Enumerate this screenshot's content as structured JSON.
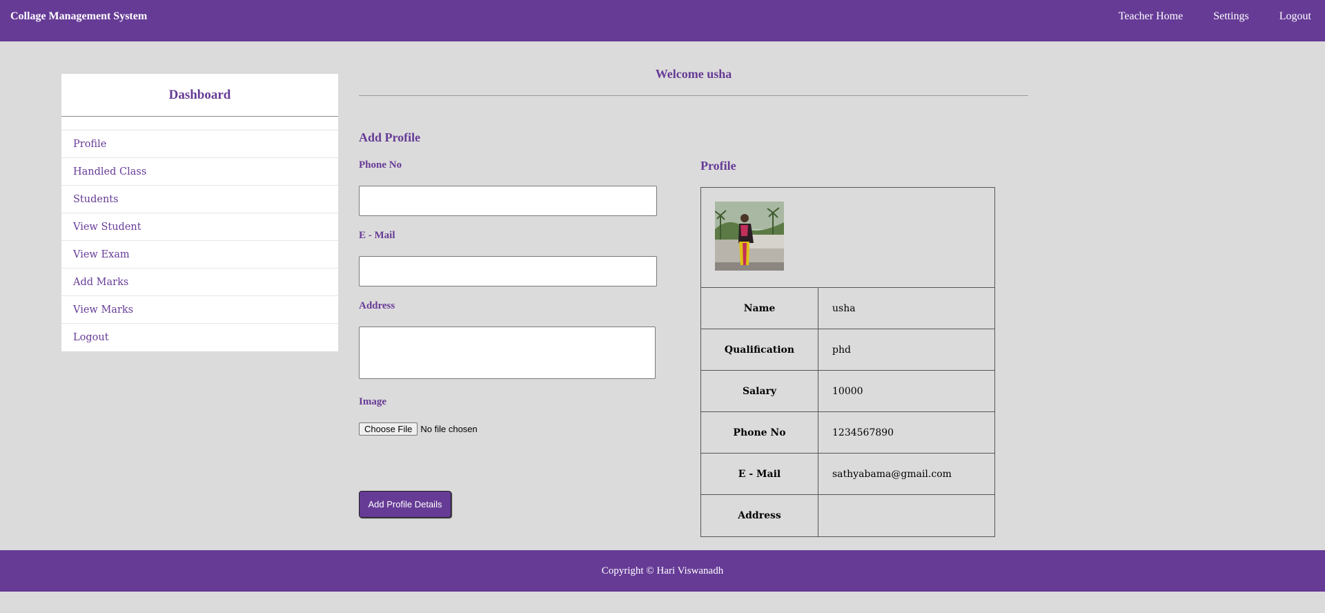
{
  "header": {
    "brand": "Collage Management System",
    "nav": [
      "Teacher Home",
      "Settings",
      "Logout"
    ]
  },
  "sidebar": {
    "title": "Dashboard",
    "items": [
      "Profile",
      "Handled Class",
      "Students",
      "View Student",
      "View Exam",
      "Add Marks",
      "View Marks",
      "Logout"
    ]
  },
  "main": {
    "welcome": "Welcome usha",
    "form": {
      "title": "Add Profile",
      "phone_label": "Phone No",
      "phone_value": "",
      "email_label": "E - Mail",
      "email_value": "",
      "address_label": "Address",
      "address_value": "",
      "image_label": "Image",
      "file_button": "Choose File",
      "file_status": "No file chosen",
      "submit_label": "Add Profile Details"
    },
    "profile": {
      "title": "Profile",
      "rows": [
        {
          "key": "Name",
          "value": "usha"
        },
        {
          "key": "Qualification",
          "value": "phd"
        },
        {
          "key": "Salary",
          "value": "10000"
        },
        {
          "key": "Phone No",
          "value": "1234567890"
        },
        {
          "key": "E - Mail",
          "value": "sathyabama@gmail.com"
        },
        {
          "key": "Address",
          "value": ""
        }
      ]
    }
  },
  "footer": {
    "text": "Copyright © Hari Viswanadh"
  },
  "colors": {
    "accent": "#663b96",
    "background": "#dcdbdb"
  }
}
